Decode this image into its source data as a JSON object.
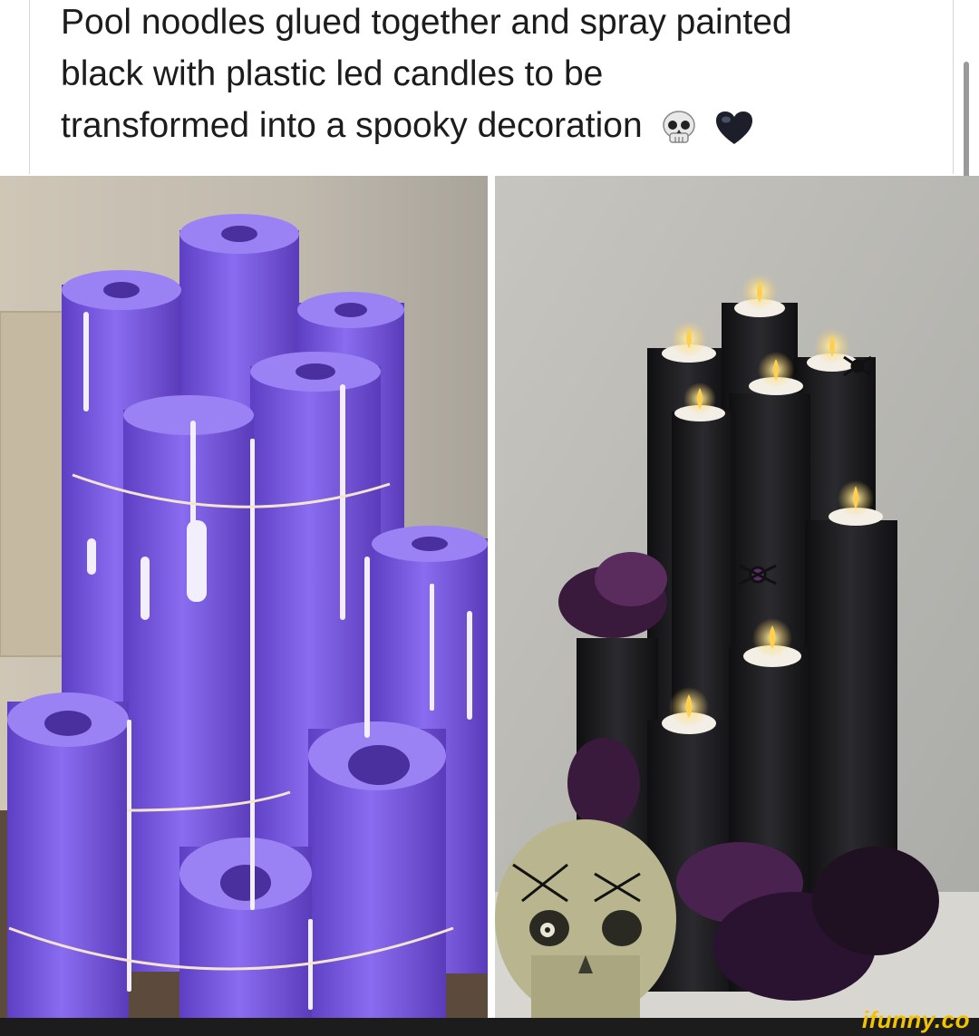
{
  "post": {
    "caption_lines": [
      "Pool noodles glued together and spray painted",
      "black with plastic led candles to be",
      "transformed into a spooky decoration"
    ],
    "caption_emojis": [
      "skull-emoji",
      "black-heart-emoji"
    ]
  },
  "images": {
    "left": {
      "subject": "purple-pool-noodles-bundle"
    },
    "right": {
      "subject": "black-painted-noodle-candles"
    }
  },
  "colors": {
    "noodle_purple": "#7d5ce0",
    "noodle_black": "#1b1b1d",
    "flame": "#ffd25a",
    "watermark": "#f2c400"
  },
  "watermark": "ifunny.co"
}
